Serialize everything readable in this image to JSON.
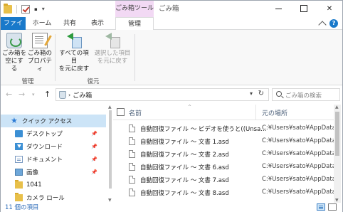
{
  "window": {
    "title": "ごみ箱",
    "context_tab_group": "ごみ箱ツール"
  },
  "ribbon_tabs": [
    {
      "label": "ファイル"
    },
    {
      "label": "ホーム"
    },
    {
      "label": "共有"
    },
    {
      "label": "表示"
    },
    {
      "label": "管理"
    }
  ],
  "ribbon": {
    "groups": [
      {
        "label": "管理",
        "buttons": [
          {
            "line1": "ごみ箱を",
            "line2": "空にする",
            "icon": "empty-recycle-bin-icon",
            "enabled": true
          },
          {
            "line1": "ごみ箱の",
            "line2": "プロパティ",
            "icon": "recycle-bin-properties-icon",
            "enabled": true
          }
        ]
      },
      {
        "label": "復元",
        "buttons": [
          {
            "line1": "すべての項目",
            "line2": "を元に戻す",
            "icon": "restore-all-icon",
            "enabled": true
          },
          {
            "line1": "選択した項目",
            "line2": "を元に戻す",
            "icon": "restore-selected-icon",
            "enabled": false
          }
        ]
      }
    ]
  },
  "address": {
    "breadcrumb": "ごみ箱",
    "search_placeholder": "ごみ箱の検索"
  },
  "nav_pane": {
    "items": [
      {
        "label": "クイック アクセス",
        "icon": "star-icon",
        "pinned": false,
        "selected": true
      },
      {
        "label": "デスクトップ",
        "icon": "desktop-icon",
        "pinned": true,
        "selected": false
      },
      {
        "label": "ダウンロード",
        "icon": "download-icon",
        "pinned": true,
        "selected": false
      },
      {
        "label": "ドキュメント",
        "icon": "documents-icon",
        "pinned": true,
        "selected": false
      },
      {
        "label": "画像",
        "icon": "pictures-icon",
        "pinned": true,
        "selected": false
      },
      {
        "label": "1041",
        "icon": "folder-icon",
        "pinned": false,
        "selected": false
      },
      {
        "label": "カメラ ロール",
        "icon": "folder-icon",
        "pinned": false,
        "selected": false
      }
    ]
  },
  "file_list": {
    "columns": {
      "name": "名前",
      "location": "元の場所"
    },
    "rows": [
      {
        "name": "自動回復ファイル 〜 ビデオを使うと((Unsa...",
        "location": "C:¥Users¥sato¥AppData"
      },
      {
        "name": "自動回復ファイル 〜 文書 1.asd",
        "location": "C:¥Users¥sato¥AppData"
      },
      {
        "name": "自動回復ファイル 〜 文書 2.asd",
        "location": "C:¥Users¥sato¥AppData"
      },
      {
        "name": "自動回復ファイル 〜 文書 6.asd",
        "location": "C:¥Users¥sato¥AppData"
      },
      {
        "name": "自動回復ファイル 〜 文書 7.asd",
        "location": "C:¥Users¥sato¥AppData"
      },
      {
        "name": "自動回復ファイル 〜 文書 8.asd",
        "location": "C:¥Users¥sato¥AppData"
      }
    ]
  },
  "status_bar": {
    "item_count": "11 個の項目"
  },
  "colors": {
    "file_tab": "#1979ca",
    "context_tab": "#f2d9f4",
    "selection": "#cce4f7"
  }
}
